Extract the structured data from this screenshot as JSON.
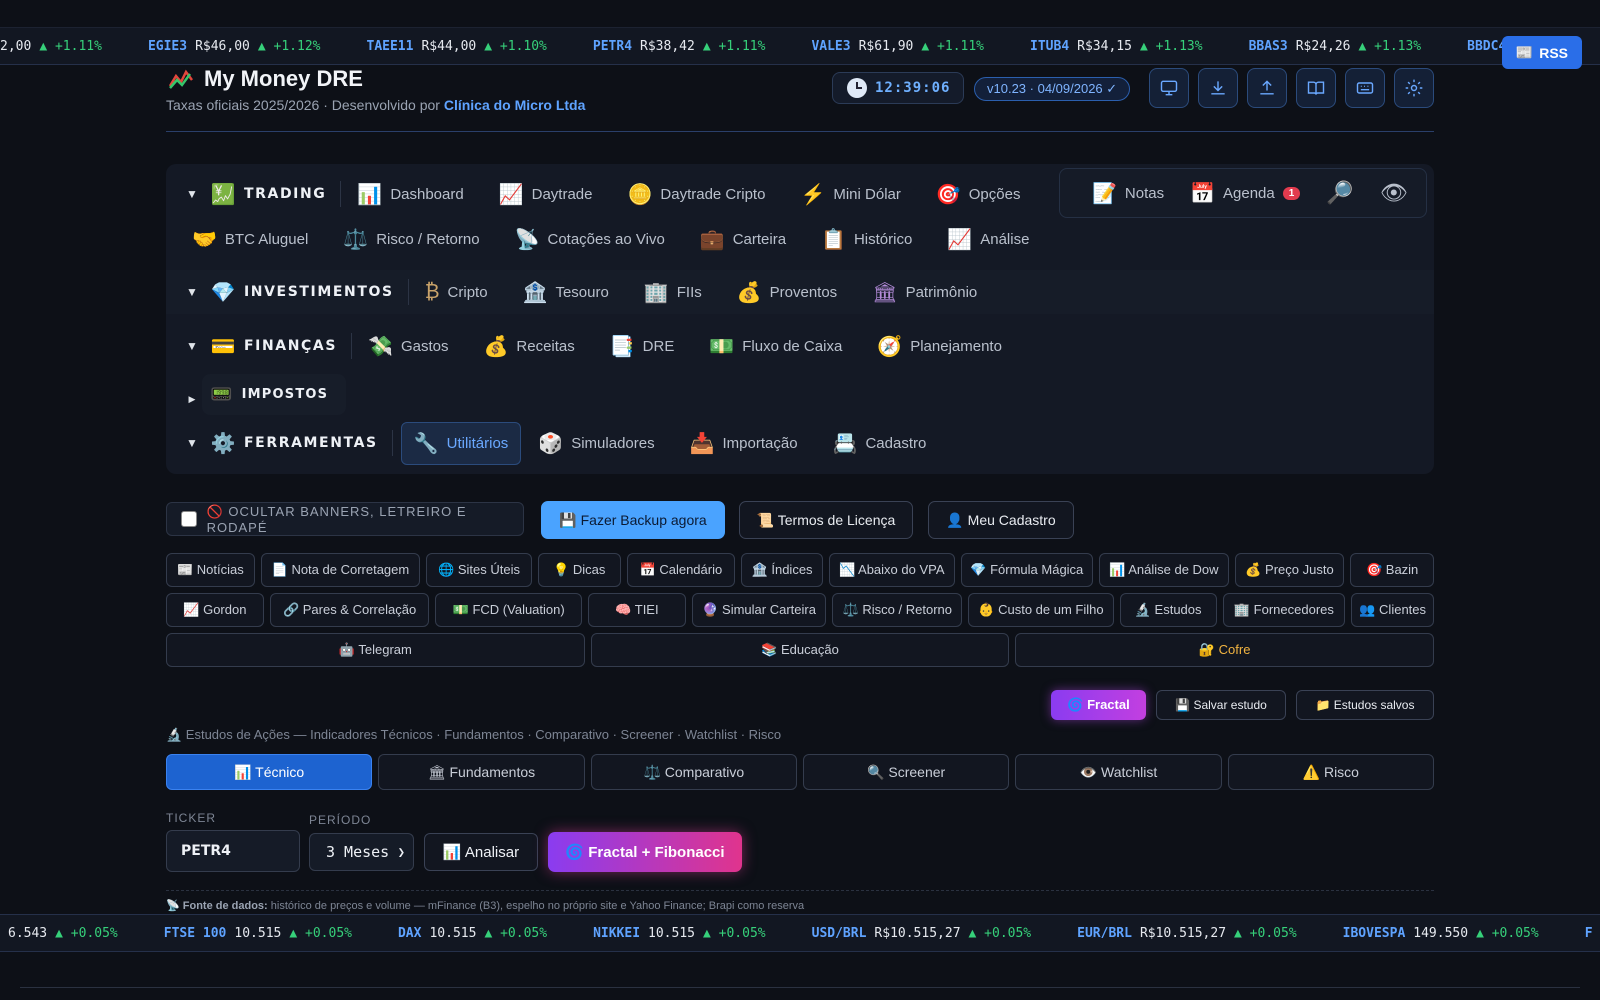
{
  "ticker_top": [
    {
      "sym": "",
      "price": "2,00",
      "chg": "▲ +1.11%"
    },
    {
      "sym": "EGIE3",
      "price": "R$46,00",
      "chg": "▲ +1.12%"
    },
    {
      "sym": "TAEE11",
      "price": "R$44,00",
      "chg": "▲ +1.10%"
    },
    {
      "sym": "PETR4",
      "price": "R$38,42",
      "chg": "▲ +1.11%"
    },
    {
      "sym": "VALE3",
      "price": "R$61,90",
      "chg": "▲ +1.11%"
    },
    {
      "sym": "ITUB4",
      "price": "R$34,15",
      "chg": "▲ +1.13%"
    },
    {
      "sym": "BBAS3",
      "price": "R$24,26",
      "chg": "▲ +1.13%"
    },
    {
      "sym": "BBDC4",
      "price": "",
      "chg": ""
    }
  ],
  "rss_label": "RSS",
  "header": {
    "title": "My Money DRE",
    "subtitle_prefix": "Taxas oficiais 2025/2026 · Desenvolvido por ",
    "subtitle_brand": "Clínica do Micro Ltda",
    "clock": "12:39:06",
    "version": "v10.23 · 04/09/2026 ✓",
    "tools": [
      "monitor-icon",
      "download-icon",
      "upload-icon",
      "book-icon",
      "keyboard-icon",
      "gear-icon"
    ]
  },
  "nav": {
    "trading": {
      "caret": "▼",
      "icon": "💹",
      "label": "TRADING",
      "items": [
        {
          "icon": "📊",
          "label": "Dashboard"
        },
        {
          "icon": "📈",
          "label": "Daytrade"
        },
        {
          "icon": "🪙",
          "label": "Daytrade Cripto"
        },
        {
          "icon": "⚡",
          "label": "Mini Dólar"
        },
        {
          "icon": "🎯",
          "label": "Opções"
        }
      ],
      "items2": [
        {
          "icon": "🤝",
          "label": "BTC Aluguel"
        },
        {
          "icon": "⚖️",
          "label": "Risco / Retorno"
        },
        {
          "icon": "📡",
          "label": "Cotações ao Vivo"
        },
        {
          "icon": "💼",
          "label": "Carteira"
        },
        {
          "icon": "📋",
          "label": "Histórico"
        },
        {
          "icon": "📈",
          "label": "Análise"
        }
      ]
    },
    "quick": {
      "notas_icon": "📝",
      "notas": "Notas",
      "agenda_icon": "📅",
      "agenda": "Agenda",
      "agenda_badge": "1",
      "search_icon": "🔎",
      "eye_icon": "👁"
    },
    "investimentos": {
      "caret": "▼",
      "icon": "💎",
      "label": "INVESTIMENTOS",
      "items": [
        {
          "icon": "₿",
          "label": "Cripto"
        },
        {
          "icon": "🏦",
          "label": "Tesouro"
        },
        {
          "icon": "🏢",
          "label": "FIIs"
        },
        {
          "icon": "💰",
          "label": "Proventos"
        },
        {
          "icon": "🏛",
          "label": "Patrimônio"
        }
      ]
    },
    "financas": {
      "caret": "▼",
      "icon": "💳",
      "label": "FINANÇAS",
      "items": [
        {
          "icon": "💸",
          "label": "Gastos"
        },
        {
          "icon": "💰",
          "label": "Receitas"
        },
        {
          "icon": "📑",
          "label": "DRE"
        },
        {
          "icon": "💵",
          "label": "Fluxo de Caixa"
        },
        {
          "icon": "🧭",
          "label": "Planejamento"
        }
      ]
    },
    "impostos": {
      "caret": "▶",
      "icon": "📟",
      "label": "IMPOSTOS"
    },
    "ferramentas": {
      "caret": "▼",
      "icon": "⚙️",
      "label": "FERRAMENTAS",
      "items": [
        {
          "icon": "🔧",
          "label": "Utilitários"
        },
        {
          "icon": "🎲",
          "label": "Simuladores"
        },
        {
          "icon": "📥",
          "label": "Importação"
        },
        {
          "icon": "📇",
          "label": "Cadastro"
        }
      ]
    }
  },
  "actions": {
    "hide_label": "🚫 OCULTAR BANNERS, LETREIRO E RODAPÉ",
    "backup": "💾 Fazer Backup agora",
    "termos": "📜 Termos de Licença",
    "cadastro": "👤 Meu Cadastro"
  },
  "utils_row1": [
    "📰 Notícias",
    "📄 Nota de Corretagem",
    "🌐 Sites Úteis",
    "💡 Dicas",
    "📅 Calendário",
    "🏦 Índices",
    "📉 Abaixo do VPA",
    "💎 Fórmula Mágica",
    "📊 Análise de Dow",
    "💰 Preço Justo",
    "🎯 Bazin"
  ],
  "utils_row2": [
    "📈 Gordon",
    "🔗 Pares & Correlação",
    "💵 FCD (Valuation)",
    "🧠 TIEI",
    "🔮 Simular Carteira",
    "⚖️ Risco / Retorno",
    "👶 Custo de um Filho",
    "🔬 Estudos",
    "🏢 Fornecedores",
    "👥 Clientes"
  ],
  "utils_row3": [
    "🤖 Telegram",
    "📚 Educação",
    "🔐 Cofre"
  ],
  "study": {
    "fractal": "🌀 Fractal",
    "salvar": "💾 Salvar estudo",
    "salvos": "📁 Estudos salvos",
    "line": "🔬 Estudos de Ações — Indicadores Técnicos · Fundamentos · Comparativo · Screener · Watchlist · Risco",
    "tabs": [
      "📊 Técnico",
      "🏛 Fundamentos",
      "⚖️ Comparativo",
      "🔍 Screener",
      "👁️ Watchlist",
      "⚠️ Risco"
    ],
    "ticker_label": "TICKER",
    "ticker_value": "PETR4",
    "period_label": "PERÍODO",
    "period_value": "3 Meses",
    "analisar": "📊 Analisar",
    "fractal_fib": "🌀 Fractal + Fibonacci",
    "source_bold": "📡 Fonte de dados:",
    "source_text": " histórico de preços e volume — mFinance (B3), espelho no próprio site e Yahoo Finance; Brapi como reserva"
  },
  "ticker_bottom": [
    {
      "sym": "",
      "price": "6.543",
      "chg": "▲ +0.05%"
    },
    {
      "sym": "FTSE 100",
      "price": "10.515",
      "chg": "▲ +0.05%"
    },
    {
      "sym": "DAX",
      "price": "10.515",
      "chg": "▲ +0.05%"
    },
    {
      "sym": "NIKKEI",
      "price": "10.515",
      "chg": "▲ +0.05%"
    },
    {
      "sym": "USD/BRL",
      "price": "R$10.515,27",
      "chg": "▲ +0.05%"
    },
    {
      "sym": "EUR/BRL",
      "price": "R$10.515,27",
      "chg": "▲ +0.05%"
    },
    {
      "sym": "IBOVESPA",
      "price": "149.550",
      "chg": "▲ +0.05%"
    },
    {
      "sym": "F",
      "price": "",
      "chg": ""
    }
  ],
  "colors": {
    "accent": "#4aa3ff",
    "up": "#36d07a",
    "bg": "#0d1017"
  }
}
